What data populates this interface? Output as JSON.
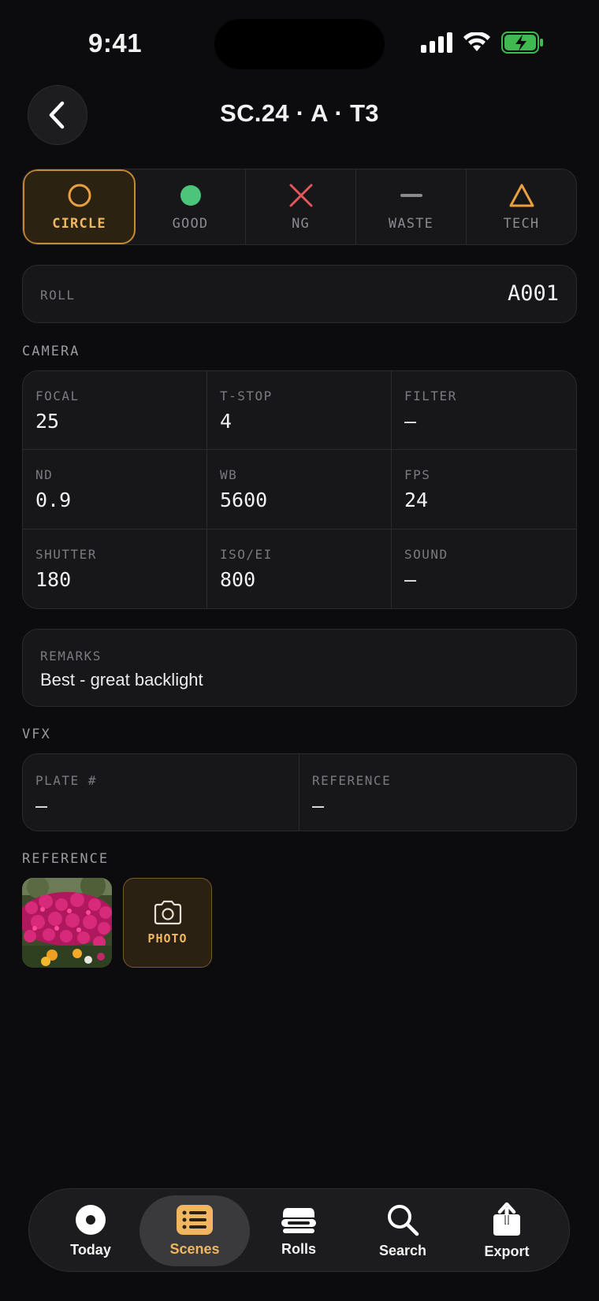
{
  "status_bar": {
    "time": "9:41"
  },
  "header": {
    "title": "SC.24 · A · T3"
  },
  "take_status": {
    "options": [
      {
        "label": "CIRCLE",
        "icon": "circle-outline-icon",
        "color": "#e8a040",
        "selected": true
      },
      {
        "label": "GOOD",
        "icon": "filled-dot-icon",
        "color": "#4cc47a",
        "selected": false
      },
      {
        "label": "NG",
        "icon": "x-mark-icon",
        "color": "#e0565a",
        "selected": false
      },
      {
        "label": "WASTE",
        "icon": "dash-icon",
        "color": "#8a8a8e",
        "selected": false
      },
      {
        "label": "TECH",
        "icon": "triangle-warning-icon",
        "color": "#e8a040",
        "selected": false
      }
    ]
  },
  "roll": {
    "label": "ROLL",
    "value": "A001"
  },
  "camera": {
    "section_label": "CAMERA",
    "fields": [
      {
        "label": "FOCAL",
        "value": "25"
      },
      {
        "label": "T-STOP",
        "value": "4"
      },
      {
        "label": "FILTER",
        "value": "—"
      },
      {
        "label": "ND",
        "value": "0.9"
      },
      {
        "label": "WB",
        "value": "5600"
      },
      {
        "label": "FPS",
        "value": "24"
      },
      {
        "label": "SHUTTER",
        "value": "180"
      },
      {
        "label": "ISO/EI",
        "value": "800"
      },
      {
        "label": "SOUND",
        "value": "—"
      }
    ]
  },
  "remarks": {
    "label": "REMARKS",
    "value": "Best - great backlight"
  },
  "vfx": {
    "section_label": "VFX",
    "fields": [
      {
        "label": "PLATE #",
        "value": "—"
      },
      {
        "label": "REFERENCE",
        "value": "—"
      }
    ]
  },
  "reference": {
    "section_label": "REFERENCE",
    "photo_button_label": "PHOTO"
  },
  "tab_bar": {
    "tabs": [
      {
        "label": "Today",
        "icon": "record-dot-icon",
        "active": false
      },
      {
        "label": "Scenes",
        "icon": "list-icon",
        "active": true
      },
      {
        "label": "Rolls",
        "icon": "film-roll-icon",
        "active": false
      },
      {
        "label": "Search",
        "icon": "search-icon",
        "active": false
      },
      {
        "label": "Export",
        "icon": "share-icon",
        "active": false
      }
    ]
  },
  "colors": {
    "accent": "#f0b760",
    "background": "#0c0c0e",
    "card": "#17171a"
  }
}
